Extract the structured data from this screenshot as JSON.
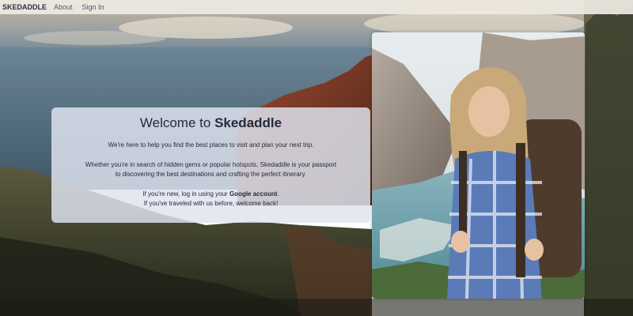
{
  "nav": {
    "brand": "SKEDADDLE",
    "links": [
      "About",
      "Sign In"
    ]
  },
  "welcome": {
    "title_prefix": "Welcome to",
    "title_brand": "Skedaddle",
    "intro": "We're here to help you find the best places to visit and plan your next trip.",
    "search_line1": "Whether you're in search of hidden gems or popular hotspots, Skedaddle is your passport",
    "search_line2": "to discovering the best destinations and crafting the perfect itinerary.",
    "new_user_prefix": "If you're new, log in using your",
    "new_user_link": "Google account",
    "new_user_suffix": ".",
    "returning": "If you've traveled with us before, welcome back!"
  },
  "colors": {
    "nav_bg": "#eeeae4",
    "brand_text": "#2c2f42",
    "card_bg": "#dee4ee",
    "ocean": "#4a6678",
    "cliff": "#7a3c2a"
  },
  "icons": {
    "hero": "hiker-photo",
    "background": "coastal-landscape"
  }
}
